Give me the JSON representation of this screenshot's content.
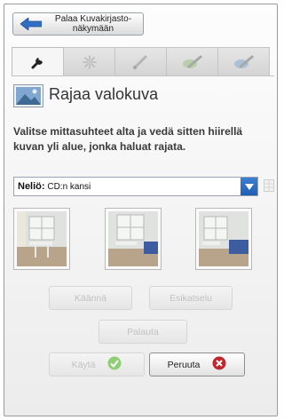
{
  "header": {
    "back_label": "Palaa Kuvakirjasto-näkymään"
  },
  "tabs": [
    {
      "icon": "wrench-icon",
      "active": true
    },
    {
      "icon": "sparkle-icon",
      "active": false
    },
    {
      "icon": "brush-icon",
      "active": false
    },
    {
      "icon": "paint-green-icon",
      "active": false
    },
    {
      "icon": "paint-blue-icon",
      "active": false
    }
  ],
  "crop": {
    "title": "Rajaa valokuva",
    "instructions": "Valitse mittasuhteet alta ja vedä sitten hiirellä kuvan yli alue, jonka haluat rajata.",
    "aspect_prefix": "Neliö:",
    "aspect_value": "CD:n kansi"
  },
  "buttons": {
    "rotate": "Käännä",
    "preview": "Esikatselu",
    "restore": "Palauta",
    "apply": "Käytä",
    "cancel": "Peruuta"
  },
  "colors": {
    "accent_blue": "#1f5fb4",
    "apply_green": "#6dbb4c",
    "cancel_red": "#c0262c"
  }
}
